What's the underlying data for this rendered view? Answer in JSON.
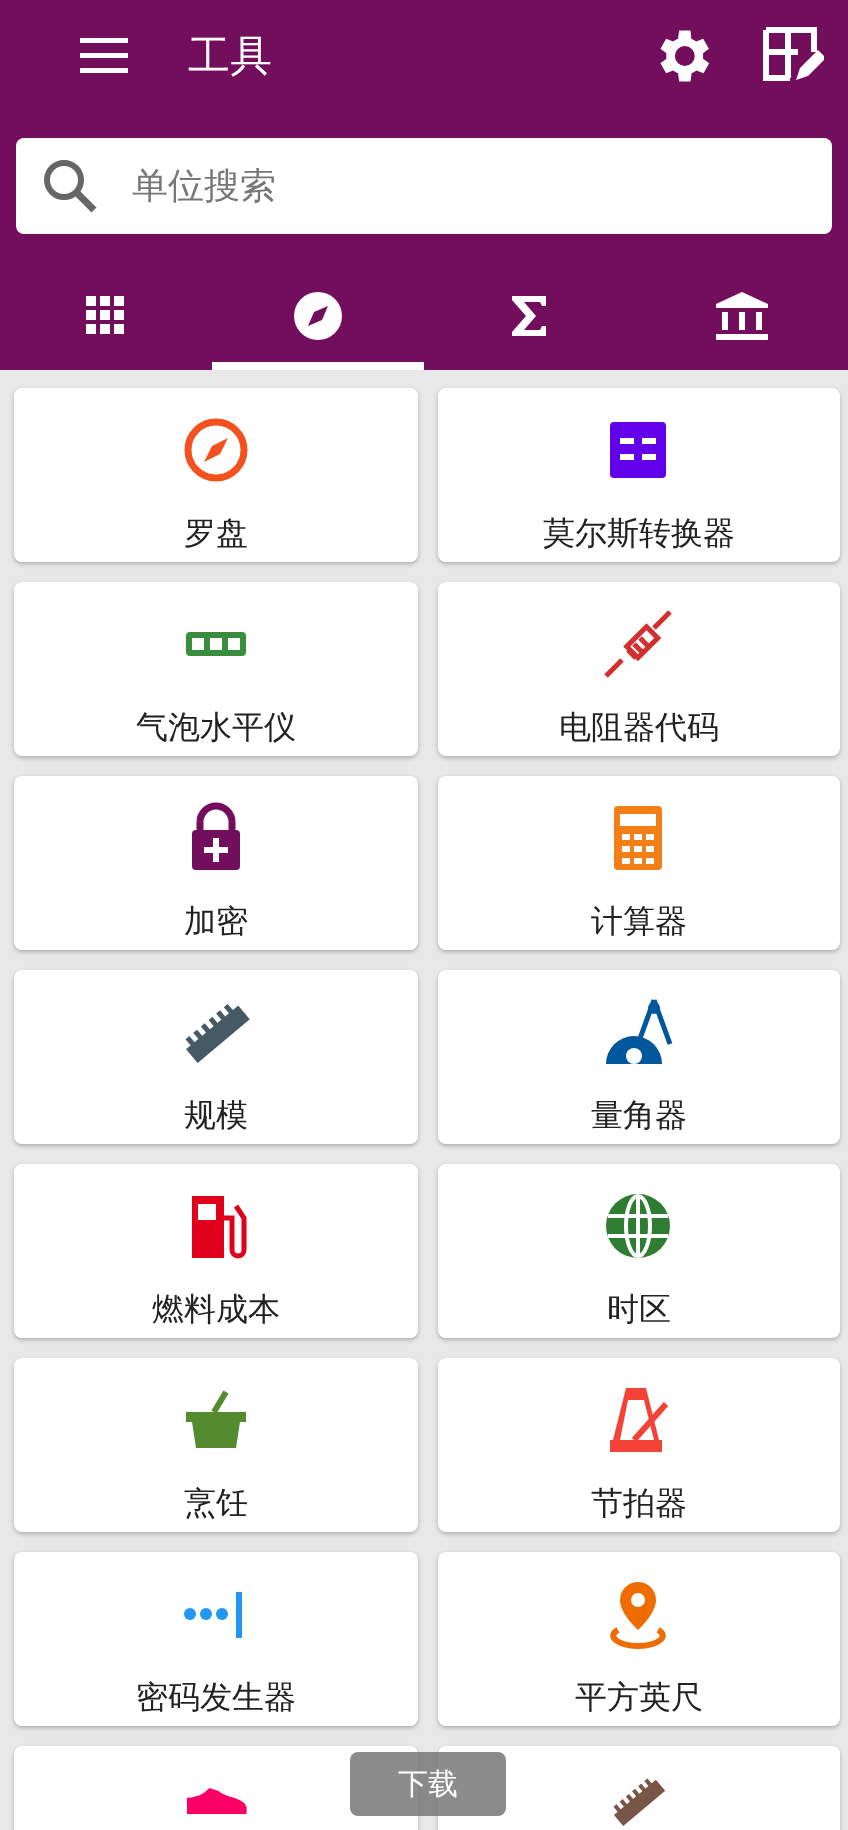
{
  "app_bar": {
    "title": "工具"
  },
  "search": {
    "placeholder": "单位搜索"
  },
  "tabs": [
    {
      "kind": "grid",
      "selected": false
    },
    {
      "kind": "compass",
      "selected": true
    },
    {
      "kind": "sigma",
      "selected": false
    },
    {
      "kind": "bank",
      "selected": false
    }
  ],
  "tools": [
    {
      "label": "罗盘",
      "kind": "compass",
      "color": "#f4511e"
    },
    {
      "label": "莫尔斯转换器",
      "kind": "morse",
      "color": "#6200ea"
    },
    {
      "label": "气泡水平仪",
      "kind": "level",
      "color": "#388e3c"
    },
    {
      "label": "电阻器代码",
      "kind": "resistor",
      "color": "#d32f2f"
    },
    {
      "label": "加密",
      "kind": "lock",
      "color": "#720e5c"
    },
    {
      "label": "计算器",
      "kind": "calculator",
      "color": "#f57f17"
    },
    {
      "label": "规模",
      "kind": "ruler",
      "color": "#455a64"
    },
    {
      "label": "量角器",
      "kind": "protractor",
      "color": "#01579b"
    },
    {
      "label": "燃料成本",
      "kind": "fuel",
      "color": "#e0001b"
    },
    {
      "label": "时区",
      "kind": "globe",
      "color": "#2e7d32"
    },
    {
      "label": "烹饪",
      "kind": "bowl",
      "color": "#558b2f"
    },
    {
      "label": "节拍器",
      "kind": "metronome",
      "color": "#f44336"
    },
    {
      "label": "密码发生器",
      "kind": "password",
      "color": "#2196f3"
    },
    {
      "label": "平方英尺",
      "kind": "pin",
      "color": "#ef6c00"
    },
    {
      "kind": "shoe",
      "color": "#ff0066"
    },
    {
      "kind": "ruler",
      "color": "#795548"
    }
  ],
  "toast": {
    "text": "下载"
  }
}
